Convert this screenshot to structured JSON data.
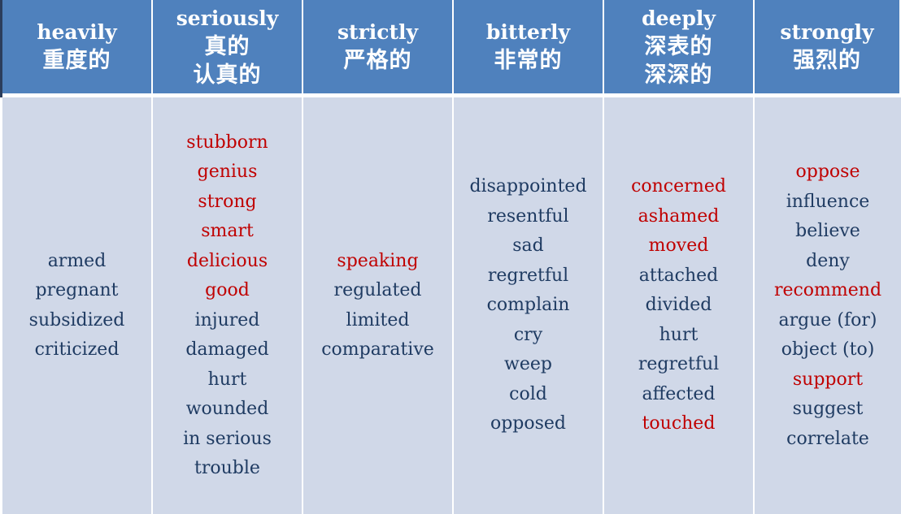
{
  "colors": {
    "header_bg": "#4f81bd",
    "body_bg": "#d0d8e8",
    "normal_text": "#1f3b62",
    "highlight_text": "#c00000"
  },
  "columns": [
    {
      "header": [
        "heavily",
        "重度的"
      ],
      "words": [
        {
          "text": "armed",
          "highlight": false
        },
        {
          "text": "pregnant",
          "highlight": false
        },
        {
          "text": "subsidized",
          "highlight": false
        },
        {
          "text": "criticized",
          "highlight": false
        }
      ]
    },
    {
      "header": [
        "seriously",
        "真的",
        "认真的"
      ],
      "words": [
        {
          "text": "stubborn",
          "highlight": true
        },
        {
          "text": "genius",
          "highlight": true
        },
        {
          "text": "strong",
          "highlight": true
        },
        {
          "text": "smart",
          "highlight": true
        },
        {
          "text": "delicious",
          "highlight": true
        },
        {
          "text": "good",
          "highlight": true
        },
        {
          "text": "injured",
          "highlight": false
        },
        {
          "text": "damaged",
          "highlight": false
        },
        {
          "text": "hurt",
          "highlight": false
        },
        {
          "text": "wounded",
          "highlight": false
        },
        {
          "text": "in serious",
          "highlight": false
        },
        {
          "text": "trouble",
          "highlight": false
        }
      ]
    },
    {
      "header": [
        "strictly",
        "严格的"
      ],
      "words": [
        {
          "text": "speaking",
          "highlight": true
        },
        {
          "text": "regulated",
          "highlight": false
        },
        {
          "text": "limited",
          "highlight": false
        },
        {
          "text": "comparative",
          "highlight": false
        }
      ]
    },
    {
      "header": [
        "bitterly",
        "非常的"
      ],
      "words": [
        {
          "text": "disappointed",
          "highlight": false
        },
        {
          "text": "resentful",
          "highlight": false
        },
        {
          "text": "sad",
          "highlight": false
        },
        {
          "text": "regretful",
          "highlight": false
        },
        {
          "text": "complain",
          "highlight": false
        },
        {
          "text": "cry",
          "highlight": false
        },
        {
          "text": "weep",
          "highlight": false
        },
        {
          "text": "cold",
          "highlight": false
        },
        {
          "text": "opposed",
          "highlight": false
        }
      ]
    },
    {
      "header": [
        "deeply",
        "深表的",
        "深深的"
      ],
      "words": [
        {
          "text": "concerned",
          "highlight": true
        },
        {
          "text": "ashamed",
          "highlight": true
        },
        {
          "text": "moved",
          "highlight": true
        },
        {
          "text": "attached",
          "highlight": false
        },
        {
          "text": "divided",
          "highlight": false
        },
        {
          "text": "hurt",
          "highlight": false
        },
        {
          "text": "regretful",
          "highlight": false
        },
        {
          "text": "affected",
          "highlight": false
        },
        {
          "text": "touched",
          "highlight": true
        }
      ]
    },
    {
      "header": [
        "strongly",
        "强烈的"
      ],
      "words": [
        {
          "text": "oppose",
          "highlight": true
        },
        {
          "text": "influence",
          "highlight": false
        },
        {
          "text": "believe",
          "highlight": false
        },
        {
          "text": "deny",
          "highlight": false
        },
        {
          "text": "recommend",
          "highlight": true
        },
        {
          "text": "argue (for)",
          "highlight": false
        },
        {
          "text": "object (to)",
          "highlight": false
        },
        {
          "text": "support",
          "highlight": true
        },
        {
          "text": "suggest",
          "highlight": false
        },
        {
          "text": "correlate",
          "highlight": false
        }
      ]
    }
  ]
}
